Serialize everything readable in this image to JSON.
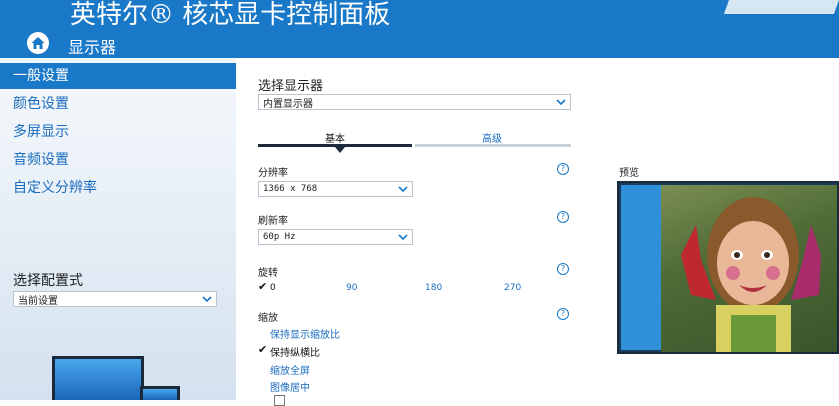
{
  "header": {
    "title": "英特尔® 核芯显卡控制面板",
    "subtitle": "显示器"
  },
  "sidebar": {
    "items": [
      {
        "label": "一般设置",
        "active": true
      },
      {
        "label": "颜色设置",
        "active": false
      },
      {
        "label": "多屏显示",
        "active": false
      },
      {
        "label": "音频设置",
        "active": false
      },
      {
        "label": "自定义分辨率",
        "active": false
      }
    ],
    "config_label": "选择配置式",
    "config_value": "当前设置"
  },
  "main": {
    "select_display_label": "选择显示器",
    "display_value": "内置显示器",
    "tabs": [
      {
        "label": "基本",
        "active": true
      },
      {
        "label": "高级",
        "active": false
      }
    ],
    "resolution_label": "分辨率",
    "resolution_value": "1366 x 768",
    "refresh_label": "刷新率",
    "refresh_value": "60p Hz",
    "rotation_label": "旋转",
    "rotation_options": [
      "0",
      "90",
      "180",
      "270"
    ],
    "rotation_selected": "0",
    "scaling_label": "缩放",
    "scaling_options": [
      {
        "label": "保持显示缩放比",
        "checked": false
      },
      {
        "label": "保持纵横比",
        "checked": true
      },
      {
        "label": "缩放全屏",
        "checked": false
      },
      {
        "label": "图像居中",
        "checked": false
      }
    ],
    "help_glyph": "?",
    "check_glyph": "✔",
    "preview_label": "预览"
  },
  "colors": {
    "brand_blue": "#1a78c8",
    "link_blue": "#1a6cc0",
    "tab_active": "#1b2a3a",
    "tab_inactive": "#c8d0d8"
  }
}
